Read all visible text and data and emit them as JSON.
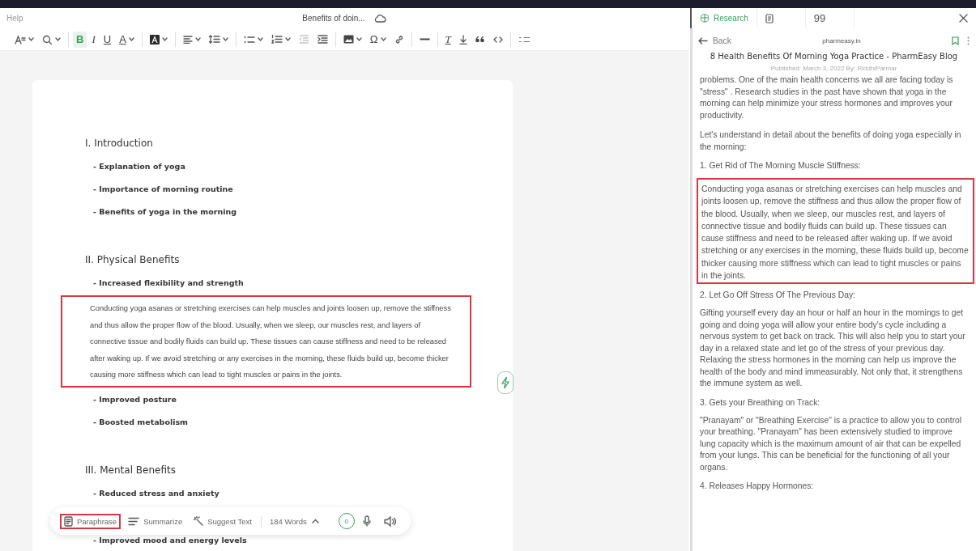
{
  "header": {
    "menu": "Help",
    "document_title": "Benefits of doin...",
    "tabs": [
      {
        "kind": "research",
        "label": "Research",
        "selected": true
      },
      {
        "kind": "notes",
        "selected": false
      },
      {
        "kind": "quote",
        "label": "99",
        "selected": false
      }
    ]
  },
  "toolbar": {
    "tools": [
      {
        "kind": "font-size",
        "dropdown": true,
        "selected": false
      },
      {
        "kind": "search",
        "dropdown": true,
        "selected": false
      },
      {
        "kind": "bold",
        "glyph": "B",
        "dropdown": false,
        "selected": true
      },
      {
        "kind": "italic",
        "glyph": "I",
        "dropdown": false,
        "selected": false
      },
      {
        "kind": "underline",
        "glyph": "U",
        "dropdown": false,
        "selected": false
      },
      {
        "kind": "font-color",
        "glyph": "A",
        "dropdown": true,
        "selected": false
      },
      {
        "kind": "highlight",
        "dropdown": true,
        "selected": false
      },
      {
        "kind": "align",
        "dropdown": true,
        "selected": false
      },
      {
        "kind": "line-height",
        "dropdown": true,
        "selected": false
      },
      {
        "kind": "bullets",
        "dropdown": true,
        "selected": false
      },
      {
        "kind": "numbers",
        "dropdown": true,
        "selected": false
      },
      {
        "kind": "outdent",
        "dropdown": false,
        "selected": false
      },
      {
        "kind": "indent",
        "dropdown": false,
        "selected": false
      },
      {
        "kind": "image",
        "dropdown": true,
        "selected": false
      },
      {
        "kind": "special-character",
        "glyph": "Ω",
        "dropdown": true,
        "selected": false
      },
      {
        "kind": "link",
        "dropdown": false,
        "selected": false
      },
      {
        "kind": "rule",
        "dropdown": false,
        "selected": false
      },
      {
        "kind": "clear-format",
        "glyph": "T",
        "dropdown": false,
        "selected": false
      },
      {
        "kind": "download",
        "dropdown": false,
        "selected": false
      },
      {
        "kind": "quote",
        "dropdown": false,
        "selected": false
      },
      {
        "kind": "code",
        "dropdown": false,
        "selected": false
      },
      {
        "kind": "task-list",
        "dropdown": false,
        "selected": false
      }
    ]
  },
  "document": {
    "blocks": [
      {
        "kind": "heading",
        "text": "I. Introduction"
      },
      {
        "kind": "item",
        "text": "- Explanation of yoga"
      },
      {
        "kind": "item",
        "text": "- Importance of morning routine"
      },
      {
        "kind": "item",
        "text": "- Benefits of yoga in the morning"
      },
      {
        "kind": "heading",
        "text": "II. Physical Benefits"
      },
      {
        "kind": "item",
        "text": "- Increased flexibility and strength"
      },
      {
        "kind": "paragraph",
        "highlighted": true,
        "text": "Conducting yoga asanas or stretching exercises can help muscles and joints loosen up, remove the stiffness and thus allow the proper flow of the blood. Usually, when we sleep, our muscles rest, and layers of connective tissue and bodily fluids can build up. These tissues can cause stiffness and need to be released after waking up. If we avoid stretching or any exercises in the morning, these fluids build up, become thicker causing more stiffness which can lead to tight muscles or pains in the joints."
      },
      {
        "kind": "item",
        "text": "- Improved posture"
      },
      {
        "kind": "item",
        "text": "- Boosted metabolism"
      },
      {
        "kind": "heading",
        "text": "III. Mental Benefits"
      },
      {
        "kind": "item",
        "text": "- Reduced stress and anxiety"
      },
      {
        "kind": "item",
        "text": "- Improved mood and energy levels"
      }
    ]
  },
  "assistant_bar": {
    "actions": [
      {
        "kind": "paraphrase",
        "label": "Paraphrase",
        "highlighted": true
      },
      {
        "kind": "summarize",
        "label": "Summarize",
        "highlighted": false
      },
      {
        "kind": "suggest",
        "label": "Suggest Text",
        "highlighted": false
      }
    ],
    "word_count": "184 Words",
    "counter": "0"
  },
  "research": {
    "back": "Back",
    "site": "pharmeasy.in",
    "title": "8 Health Benefits Of Morning Yoga Practice - PharmEasy Blog",
    "published": "Published: March 3, 2022  By: RiddhiParmar",
    "blocks": [
      {
        "kind": "paragraph",
        "highlighted": false,
        "text": "problems. One of the main health concerns we all are facing today is \"stress\"  . Research studies in the past have shown that yoga in the morning can help minimize your stress hormones and improves your productivity."
      },
      {
        "kind": "paragraph",
        "highlighted": false,
        "text": "Let's understand in detail about the benefits of doing yoga especially in the morning:"
      },
      {
        "kind": "heading",
        "text": "1. Get Rid of The Morning Muscle Stiffness:"
      },
      {
        "kind": "paragraph",
        "highlighted": true,
        "text": "Conducting yoga asanas or stretching exercises can help muscles and joints loosen up, remove the stiffness and thus allow the proper flow of the blood. Usually, when we sleep, our muscles rest, and layers of connective tissue and bodily fluids can build up. These tissues can cause stiffness and need to be released after waking up. If we avoid stretching or any exercises in the morning, these fluids build up, become thicker causing more stiffness which can lead to tight muscles or pains in the joints."
      },
      {
        "kind": "heading",
        "text": "2. Let Go Off Stress Of The Previous Day:"
      },
      {
        "kind": "paragraph",
        "highlighted": false,
        "text": "Gifting yourself every day an hour or half an hour in the mornings to get going and doing yoga will allow your entire body's cycle including a nervous system to get back on track. This will also help you to start your day in a relaxed state and let go of the stress of your previous day. Relaxing the stress hormones in the morning can help us improve the health of the body and mind immeasurably. Not only that, it strengthens the immune system as well."
      },
      {
        "kind": "heading",
        "text": "3. Gets your Breathing on Track:"
      },
      {
        "kind": "paragraph",
        "highlighted": false,
        "text": "\"Pranayam\"   or \"Breathing Exercise\"   is a practice to allow you to control your breathing. \"Pranayam\"   has been extensively studied to improve lung capacity which is the maximum amount of air that can be expelled from your lungs. This can be beneficial for the functioning of all your organs."
      },
      {
        "kind": "heading",
        "text": "4. Releases Happy Hormones:"
      }
    ]
  }
}
